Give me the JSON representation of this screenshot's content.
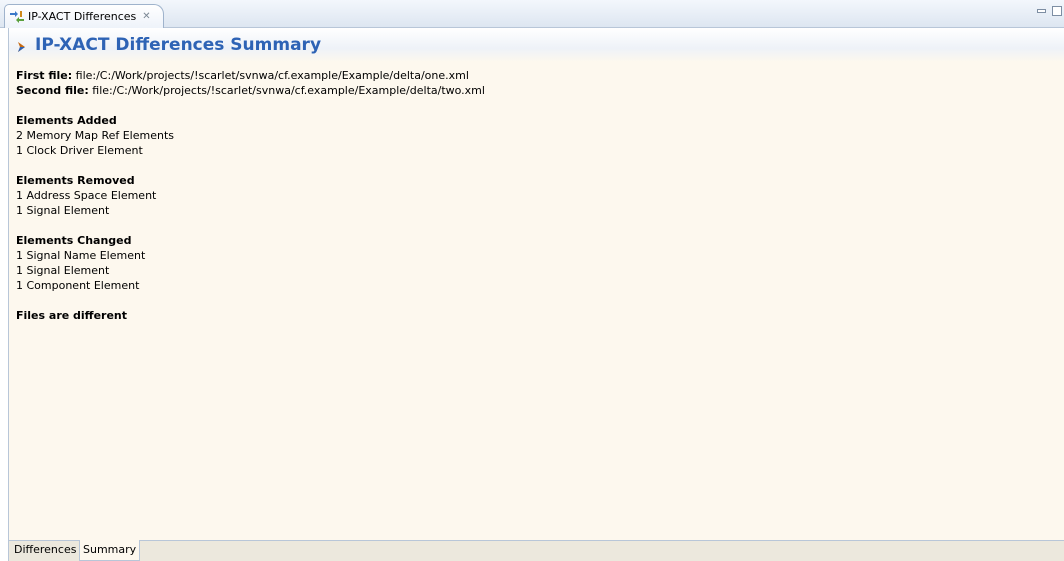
{
  "editor_tab": {
    "label": "IP-XACT Differences",
    "close_glyph": "✕",
    "icon": "diff-icon"
  },
  "window_controls": {
    "minimize_icon": "minimize-icon",
    "maximize_icon": "maximize-icon"
  },
  "header": {
    "title": "IP-XACT Differences Summary",
    "icon": "arrow-diamond-icon"
  },
  "files": {
    "first_label": "First file:",
    "first_value": "file:/C:/Work/projects/!scarlet/svnwa/cf.example/Example/delta/one.xml",
    "second_label": "Second file:",
    "second_value": "file:/C:/Work/projects/!scarlet/svnwa/cf.example/Example/delta/two.xml"
  },
  "sections": [
    {
      "heading": "Elements Added",
      "items": [
        "2 Memory Map Ref Elements",
        "1 Clock Driver Element"
      ]
    },
    {
      "heading": "Elements Removed",
      "items": [
        "1 Address Space Element",
        "1 Signal Element"
      ]
    },
    {
      "heading": "Elements Changed",
      "items": [
        "1 Signal Name Element",
        "1 Signal Element",
        "1 Component Element"
      ]
    }
  ],
  "result": "Files are different",
  "page_tabs": {
    "differences": "Differences",
    "summary": "Summary",
    "active": "Summary"
  },
  "colors": {
    "title": "#2e63b5",
    "content_background": "#fdf8ee"
  }
}
